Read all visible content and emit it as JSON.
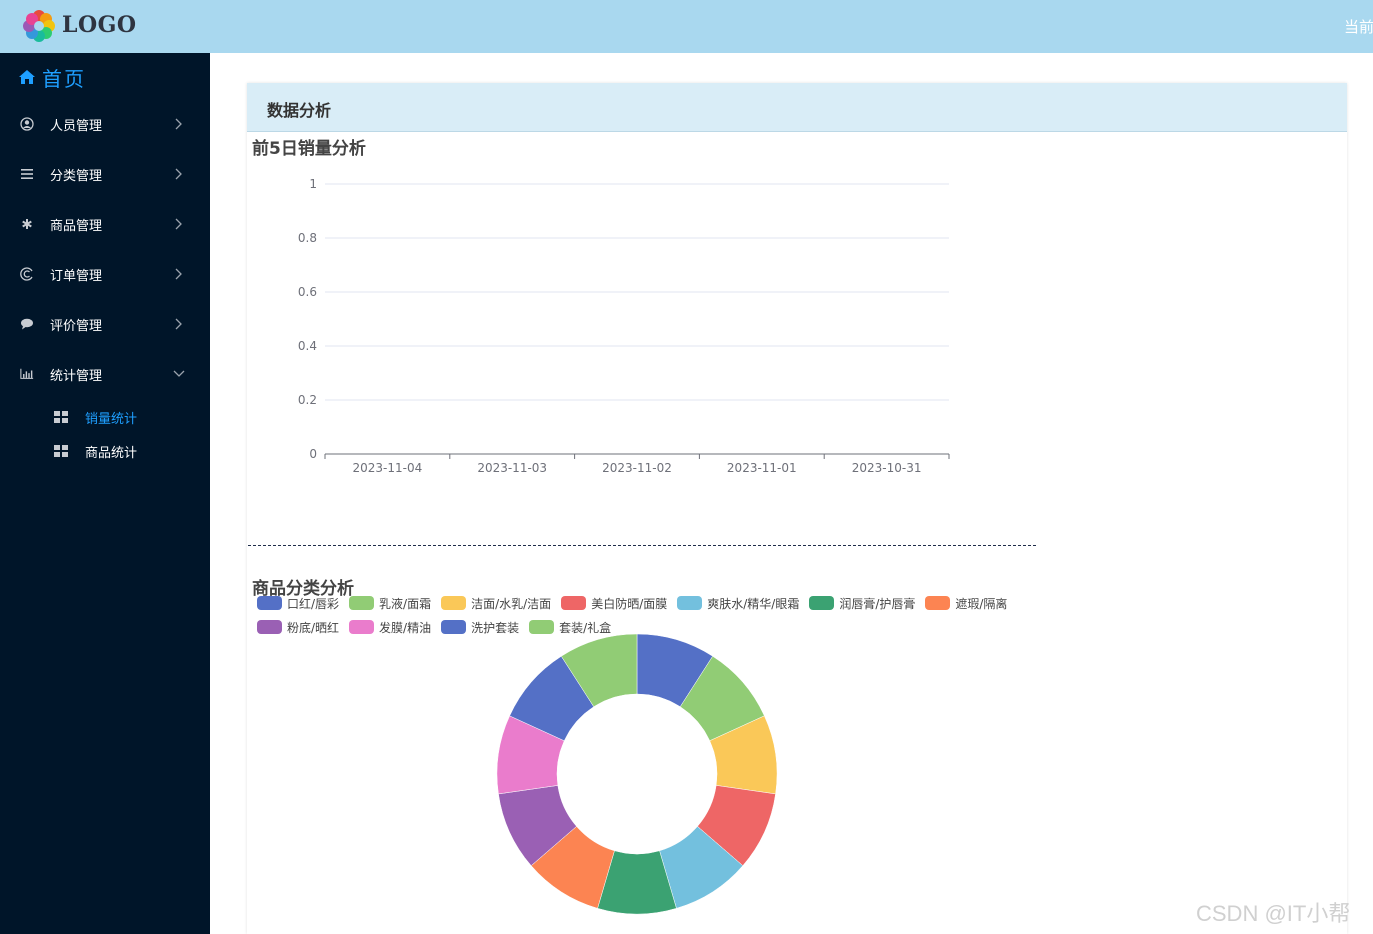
{
  "header": {
    "logo_text": "LOGO",
    "user_text": "当前"
  },
  "sidebar": {
    "home_label": "首页",
    "items": [
      {
        "label": "人员管理",
        "icon": "user-circle-icon"
      },
      {
        "label": "分类管理",
        "icon": "list-icon"
      },
      {
        "label": "商品管理",
        "icon": "asterisk-icon"
      },
      {
        "label": "订单管理",
        "icon": "swirl-icon"
      },
      {
        "label": "评价管理",
        "icon": "comment-icon"
      },
      {
        "label": "统计管理",
        "icon": "bar-chart-icon"
      }
    ],
    "sub_items": [
      {
        "label": "销量统计",
        "icon": "grid-icon",
        "active": true
      },
      {
        "label": "商品统计",
        "icon": "grid-icon",
        "active": false
      }
    ]
  },
  "card": {
    "title": "数据分析"
  },
  "charts": {
    "sales_title": "前5日销量分析",
    "category_title": "商品分类分析"
  },
  "chart_data": [
    {
      "type": "line",
      "title": "前5日销量分析",
      "categories": [
        "2023-11-04",
        "2023-11-03",
        "2023-11-02",
        "2023-11-01",
        "2023-10-31"
      ],
      "series": [],
      "yticks": [
        "0",
        "0.2",
        "0.4",
        "0.6",
        "0.8",
        "1"
      ],
      "ylim": [
        0,
        1
      ],
      "grid": true
    },
    {
      "type": "pie",
      "title": "商品分类分析",
      "donut": true,
      "legend_position": "top-left",
      "labels": [
        "口红/唇彩",
        "乳液/面霜",
        "洁面/水乳/洁面",
        "美白防晒/面膜",
        "爽肤水/精华/眼霜",
        "润唇膏/护唇膏",
        "遮瑕/隔离",
        "粉底/晒红",
        "发膜/精油",
        "洗护套装",
        "套装/礼盒"
      ],
      "values": [
        1,
        1,
        1,
        1,
        1,
        1,
        1,
        1,
        1,
        1,
        1
      ],
      "colors": [
        "#5470c6",
        "#91cc75",
        "#fac858",
        "#ee6666",
        "#73c0de",
        "#3ba272",
        "#fc8452",
        "#9a60b4",
        "#ea7ccc",
        "#5470c6",
        "#91cc75"
      ]
    }
  ],
  "watermark": "CSDN @IT小帮"
}
